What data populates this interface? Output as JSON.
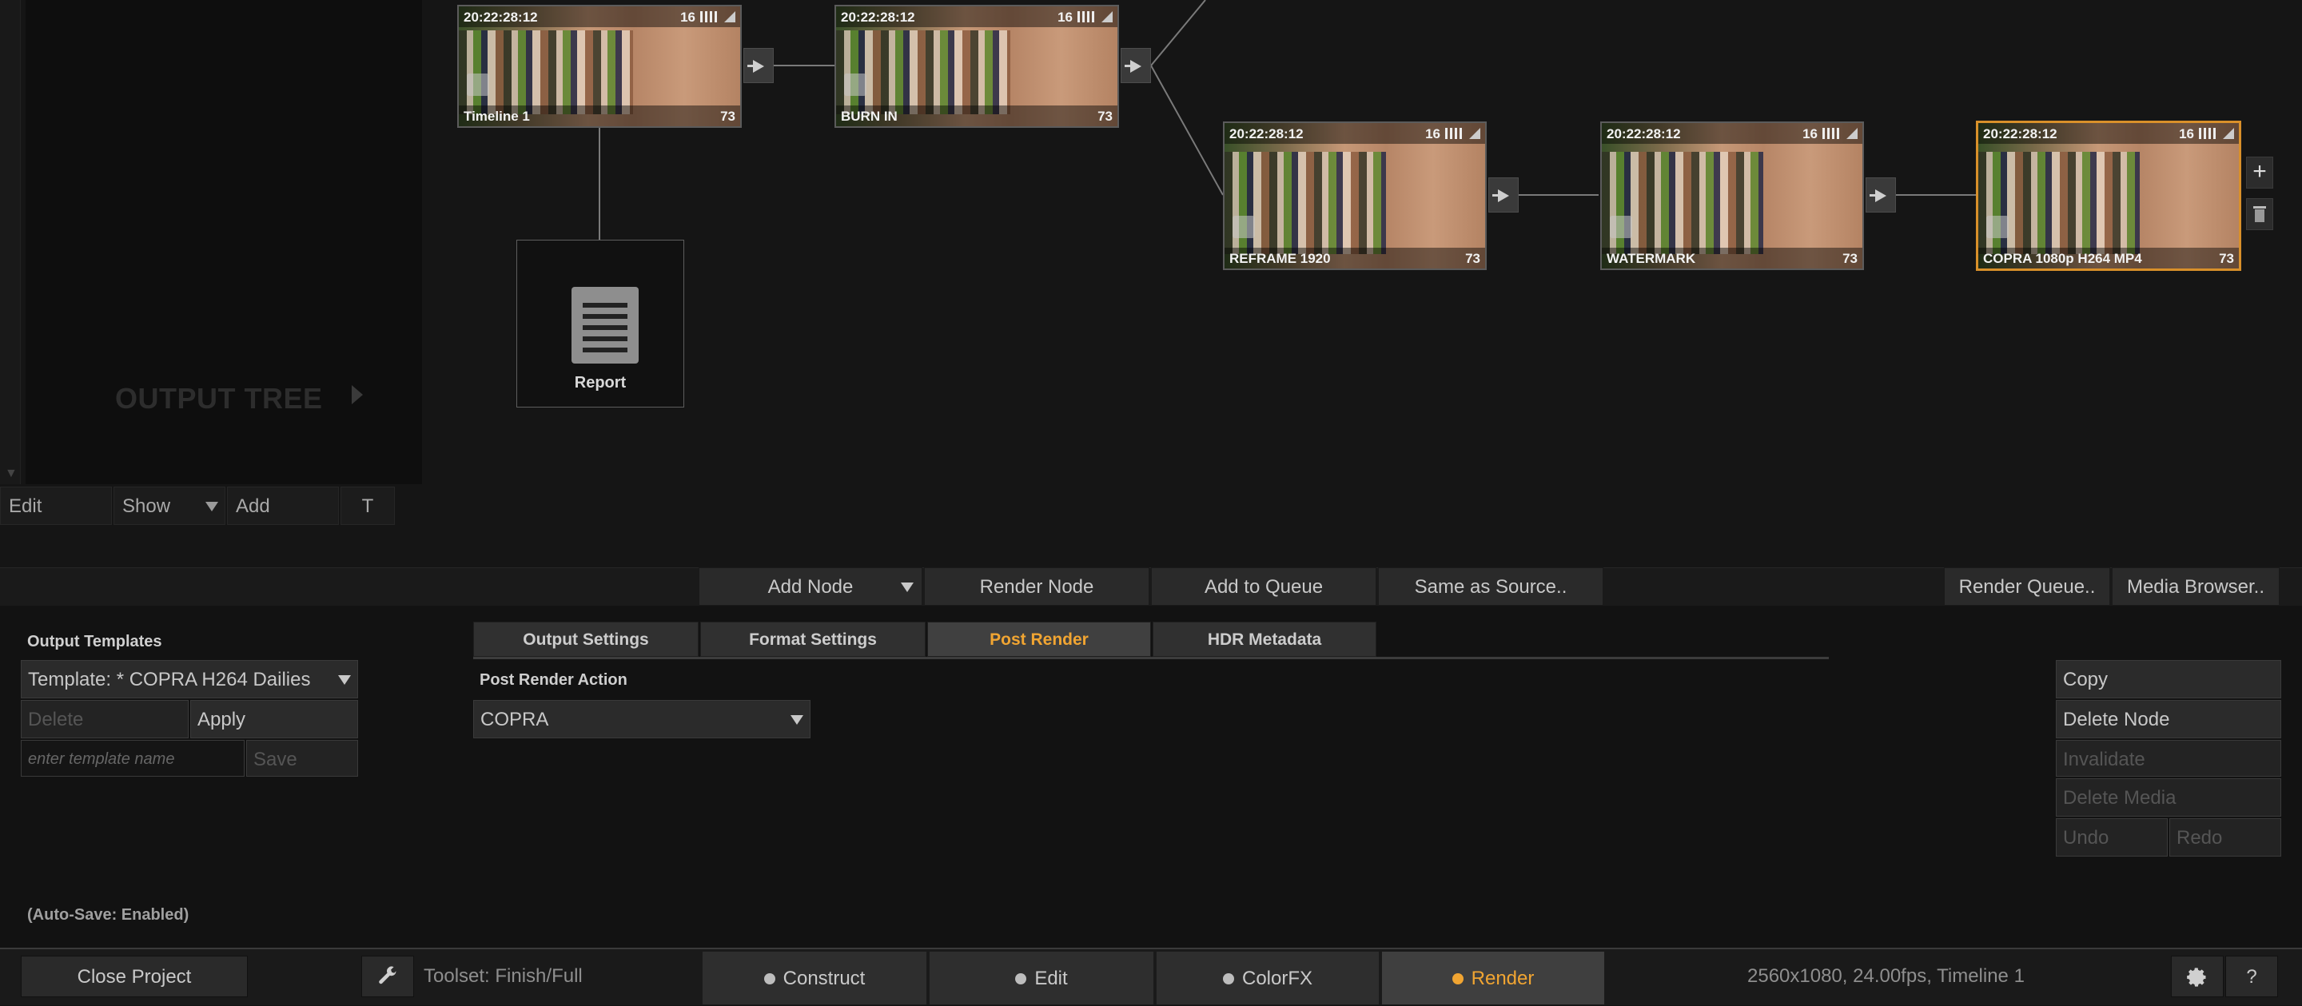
{
  "output_tree": {
    "label": "OUTPUT TREE",
    "toolbar": {
      "edit": "Edit",
      "show": "Show",
      "add": "Add",
      "t": "T"
    }
  },
  "nodes": [
    {
      "timecode": "20:22:28:12",
      "bits": "16",
      "name": "Timeline 1",
      "frames": "73"
    },
    {
      "timecode": "20:22:28:12",
      "bits": "16",
      "name": "BURN IN",
      "frames": "73"
    },
    {
      "timecode": "20:22:28:12",
      "bits": "16",
      "name": "REFRAME 1920",
      "frames": "73"
    },
    {
      "timecode": "20:22:28:12",
      "bits": "16",
      "name": "WATERMARK",
      "frames": "73"
    },
    {
      "timecode": "20:22:28:12",
      "bits": "16",
      "name": "COPRA 1080p H264 MP4",
      "frames": "73",
      "selected": true
    }
  ],
  "report_node": {
    "label": "Report"
  },
  "graph_side": {
    "add": "+",
    "trash": ""
  },
  "action_bar": {
    "add_node": "Add Node",
    "render_node": "Render Node",
    "add_to_queue": "Add to Queue",
    "same_as_source": "Same as Source..",
    "render_queue": "Render Queue..",
    "media_browser": "Media Browser.."
  },
  "output_templates": {
    "title": "Output Templates",
    "template": "Template: * COPRA H264 Dailies",
    "delete": "Delete",
    "apply": "Apply",
    "name_placeholder": "enter template name",
    "save": "Save",
    "autosave": "(Auto-Save: Enabled)"
  },
  "tabs": [
    "Output Settings",
    "Format Settings",
    "Post Render",
    "HDR Metadata"
  ],
  "active_tab": "Post Render",
  "post_render": {
    "label": "Post Render Action",
    "value": "COPRA"
  },
  "node_actions": {
    "copy": "Copy",
    "delete_node": "Delete Node",
    "invalidate": "Invalidate",
    "delete_media": "Delete Media",
    "undo": "Undo",
    "redo": "Redo"
  },
  "bottom_bar": {
    "close_project": "Close Project",
    "toolset": "Toolset: Finish/Full",
    "modes": [
      "Construct",
      "Edit",
      "ColorFX",
      "Render"
    ],
    "active_mode": "Render",
    "status": "2560x1080, 24.00fps, Timeline 1",
    "help": "?"
  },
  "colors": {
    "accent": "#f1a532",
    "selected_border": "#d9902a"
  }
}
